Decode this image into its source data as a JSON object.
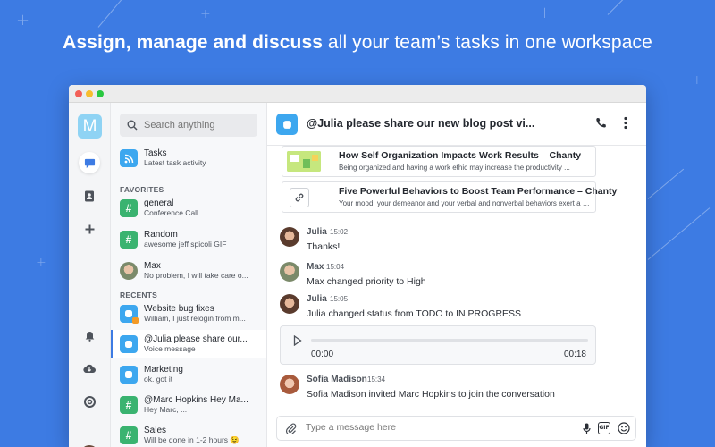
{
  "headline": {
    "bold": "Assign, manage and discuss",
    "regular": " all your team’s tasks in one workspace"
  },
  "workspace": {
    "initial": "M"
  },
  "search": {
    "placeholder": "Search anything"
  },
  "sidebar": {
    "tasks": {
      "title": "Tasks",
      "subtitle": "Latest task activity"
    },
    "favorites_label": "FAVORITES",
    "favorites": [
      {
        "title": "general",
        "subtitle": "Conference Call"
      },
      {
        "title": "Random",
        "subtitle": "awesome jeff spicoli GIF"
      },
      {
        "title": "Max",
        "subtitle": "No problem, I will take care o..."
      }
    ],
    "recents_label": "RECENTS",
    "recents": [
      {
        "title": "Website bug fixes",
        "subtitle": "William, I just relogin from m..."
      },
      {
        "title": "@Julia please share our...",
        "subtitle": "Voice message"
      },
      {
        "title": "Marketing",
        "subtitle": "ok. got it"
      },
      {
        "title": "@Marc Hopkins Hey Ma...",
        "subtitle": "Hey Marc, ..."
      },
      {
        "title": "Sales",
        "subtitle": "Will be done in 1-2 hours 😉"
      }
    ],
    "hash_symbol": "#"
  },
  "chat": {
    "title": "@Julia please share our new blog post vi...",
    "link_cards": [
      {
        "title": "How Self Organization Impacts Work Results – Chanty",
        "desc": "Being organized and having a work ethic may increase the productivity ..."
      },
      {
        "title": "Five Powerful Behaviors to Boost Team Performance – Chanty",
        "desc": "Your mood, your demeanor and your verbal and nonverbal behaviors exert a powerf..."
      }
    ],
    "messages": [
      {
        "name": "Julia",
        "time": "15:02",
        "text": "Thanks!"
      },
      {
        "name": "Max",
        "time": "15:04",
        "text": "Max changed priority to High"
      },
      {
        "name": "Julia",
        "time": "15:05",
        "text": "Julia changed status from TODO to IN PROGRESS"
      },
      {
        "name": "Sofia Madison",
        "time": "15:34",
        "text": "Sofia Madison invited Marc Hopkins to join the conversation"
      }
    ],
    "voice": {
      "current": "00:00",
      "duration": "00:18",
      "progress": 0
    }
  },
  "composer": {
    "placeholder": "Type a message here"
  },
  "colors": {
    "background": "#3d7be3",
    "green_channel": "#3ab370",
    "blue_channel": "#3da7ef",
    "workspace_badge": "#8fd3f4"
  }
}
